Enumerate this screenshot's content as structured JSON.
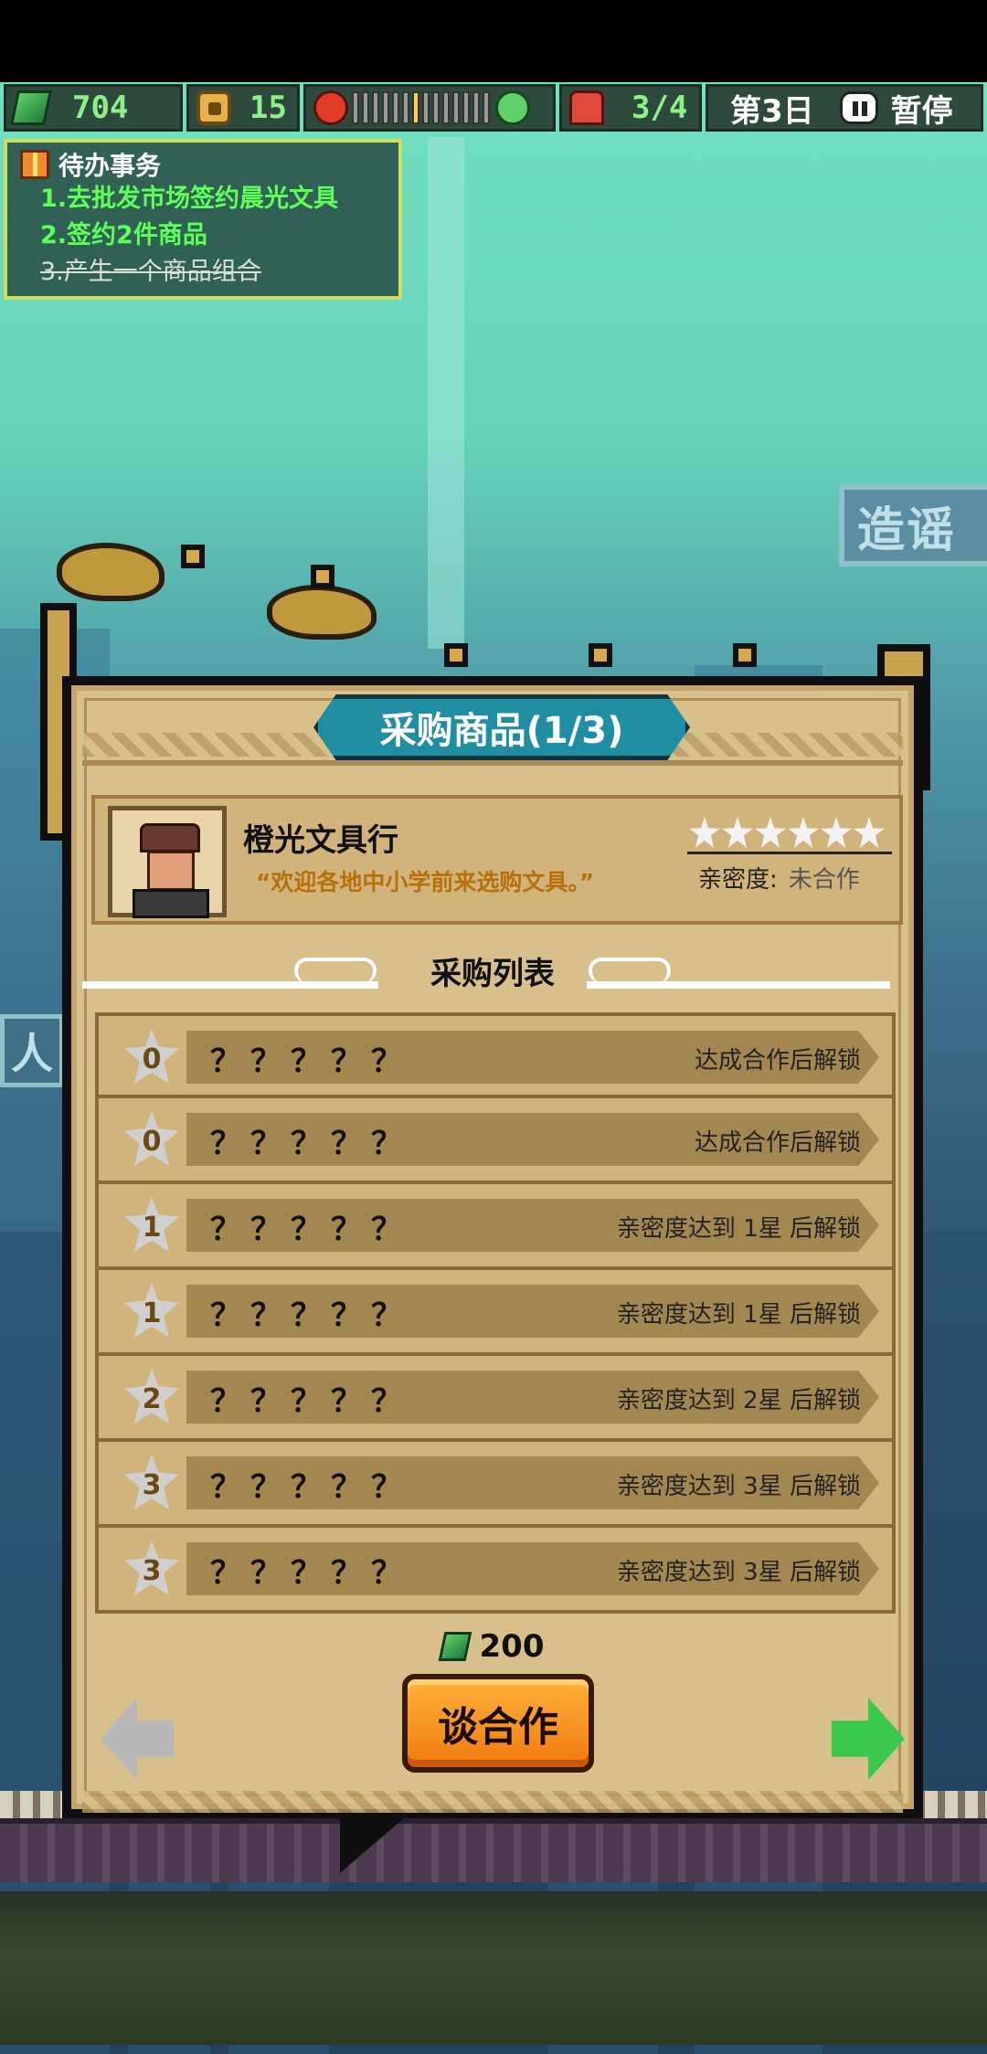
{
  "hud": {
    "money": "704",
    "coins": "15",
    "mood_level": 7,
    "mood_total": 14,
    "staff": "3/4",
    "day": "第3日",
    "pause_label": "暂停"
  },
  "tasks": {
    "title": "待办事务",
    "items": [
      {
        "text": "1.去批发市场签约晨光文具",
        "done": false
      },
      {
        "text": "2.签约2件商品",
        "done": false
      },
      {
        "text": "3.产生一个商品组合",
        "done": true
      }
    ]
  },
  "background": {
    "sign_text": "造谣",
    "sign_left_text": "人"
  },
  "panel": {
    "title": "采购商品(1/3)",
    "vendor": {
      "name": "橙光文具行",
      "quote": "“欢迎各地中小学前来选购文具。”",
      "stars_total": 6,
      "stars_filled": 0,
      "intimacy_label": "亲密度:",
      "intimacy_value": "未合作"
    },
    "list_title": "采购列表",
    "rows": [
      {
        "level": "0",
        "name": "？？？？？",
        "unlock": "达成合作后解锁"
      },
      {
        "level": "0",
        "name": "？？？？？",
        "unlock": "达成合作后解锁"
      },
      {
        "level": "1",
        "name": "？？？？？",
        "unlock": "亲密度达到 1星 后解锁"
      },
      {
        "level": "1",
        "name": "？？？？？",
        "unlock": "亲密度达到 1星 后解锁"
      },
      {
        "level": "2",
        "name": "？？？？？",
        "unlock": "亲密度达到 2星 后解锁"
      },
      {
        "level": "3",
        "name": "？？？？？",
        "unlock": "亲密度达到 3星 后解锁"
      },
      {
        "level": "3",
        "name": "？？？？？",
        "unlock": "亲密度达到 3星 后解锁"
      }
    ],
    "price": "200",
    "talk_button": "谈合作"
  },
  "colors": {
    "accent_green": "#5fff5a",
    "banner_teal": "#1f8ea2",
    "button_orange": "#f79a22",
    "quote_orange": "#b8700a"
  }
}
